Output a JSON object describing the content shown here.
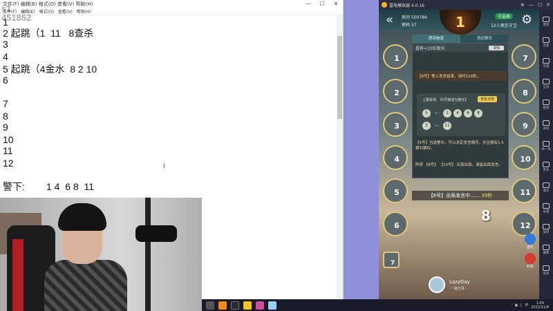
{
  "notepad": {
    "title": "文件(F)  编辑(E)  格式(O)  查看(V)  帮助(H)",
    "watermark_line1": "s1",
    "watermark_line2": "451852",
    "menu": [
      "文件(F)",
      "编辑(E)",
      "格式(O)",
      "查看(V)",
      "帮助(H)"
    ],
    "lines": [
      "1",
      "2 起跳（1  11   8查杀",
      "3",
      "4",
      "5 起跳（4金水  8 2 10",
      "6",
      "",
      "7",
      "8",
      "9",
      "10",
      "11",
      "12",
      "",
      "警下:        1 4  6 8  11"
    ],
    "window_controls": [
      "—",
      "☐",
      "✕"
    ]
  },
  "emulator": {
    "title": "雷电模拟器 4.0.16",
    "window_controls": [
      "≡",
      "—",
      "☐",
      "✕"
    ],
    "tools": [
      "键盘",
      "音量",
      "音量",
      "全屏",
      "截图",
      "录屏",
      "摇一摇",
      "更多",
      "操作",
      "设置",
      "旋转",
      "摄像",
      "安装"
    ]
  },
  "game": {
    "room_label": "房间 500786",
    "password_label": "密码 57",
    "day_label": "1",
    "mode_tag": "守选格",
    "mode_label": "12人预言守卫",
    "tabs": [
      "房间信息",
      "待定聊天"
    ],
    "online_text": "投有<10位观众",
    "detail_button": "详情",
    "msg1": "【8号】警上发言结束，用时118秒。",
    "vote_title": "上警投票: 【5号被选为警长】",
    "vote_button": "查看详情",
    "vote_row1_from": "5",
    "vote_row1_to": [
      "1",
      "4",
      "6",
      "8"
    ],
    "vote_row2_from": "2",
    "vote_row2_to": [
      "11"
    ],
    "msg2": "【5号】当选警长。可以决定发言顺序，并且拥有1.5票归票权。",
    "msg3": "昨夜 【8号】 【10号】 玩家出局，请留出局发言。",
    "speak_text": "【8号】出局发言中……",
    "speak_seconds": "39秒",
    "big_number": "8",
    "seats_left": [
      "1",
      "2",
      "3",
      "4",
      "5",
      "6"
    ],
    "seats_right": [
      "7",
      "8",
      "9",
      "10",
      "11",
      "12"
    ],
    "bottom_left_seat": "7",
    "me_name": "LazyDay",
    "me_sub": "一路无事",
    "side_buttons": [
      "送礼",
      "红包"
    ]
  },
  "taskbar": {
    "time": "1:09",
    "date": "2022/11/8",
    "lang": "中"
  }
}
